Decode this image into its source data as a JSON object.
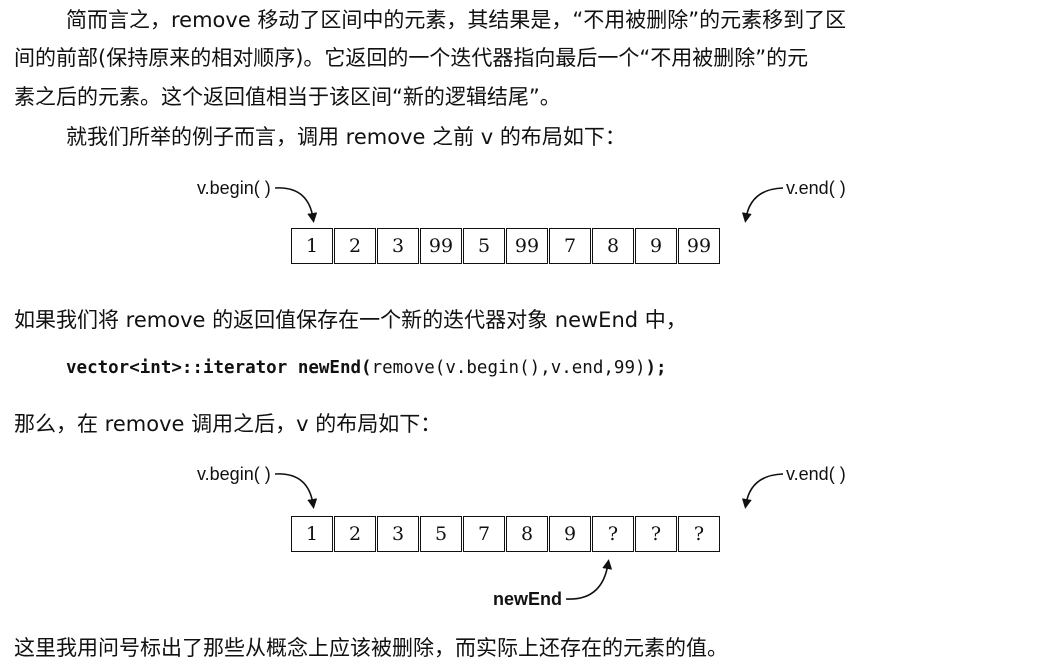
{
  "paragraph1": {
    "line1": "简而言之，remove 移动了区间中的元素，其结果是，“不用被删除”的元素移到了区",
    "line2": "间的前部(保持原来的相对顺序)。它返回的一个迭代器指向最后一个“不用被删除”的元",
    "line3": "素之后的元素。这个返回值相当于该区间“新的逻辑结尾”。"
  },
  "paragraph2": "就我们所举的例子而言，调用 remove 之前 v 的布局如下：",
  "diagram_before": {
    "begin_label": "v.begin( )",
    "end_label": "v.end( )",
    "cells": [
      "1",
      "2",
      "3",
      "99",
      "5",
      "99",
      "7",
      "8",
      "9",
      "99"
    ]
  },
  "paragraph3": "如果我们将 remove 的返回值保存在一个新的迭代器对象 newEnd 中，",
  "code": {
    "kw1": "vector<int>::iterator",
    "kw2": "newEnd(",
    "plain": "remove(v.begin(),v.end,99)",
    "end": ");"
  },
  "paragraph4": "那么，在 remove 调用之后，v 的布局如下：",
  "diagram_after": {
    "begin_label": "v.begin( )",
    "end_label": "v.end( )",
    "new_end_label": "newEnd",
    "cells": [
      "1",
      "2",
      "3",
      "5",
      "7",
      "8",
      "9",
      "?",
      "?",
      "?"
    ]
  },
  "paragraph5": "这里我用问号标出了那些从概念上应该被删除，而实际上还存在的元素的值。"
}
